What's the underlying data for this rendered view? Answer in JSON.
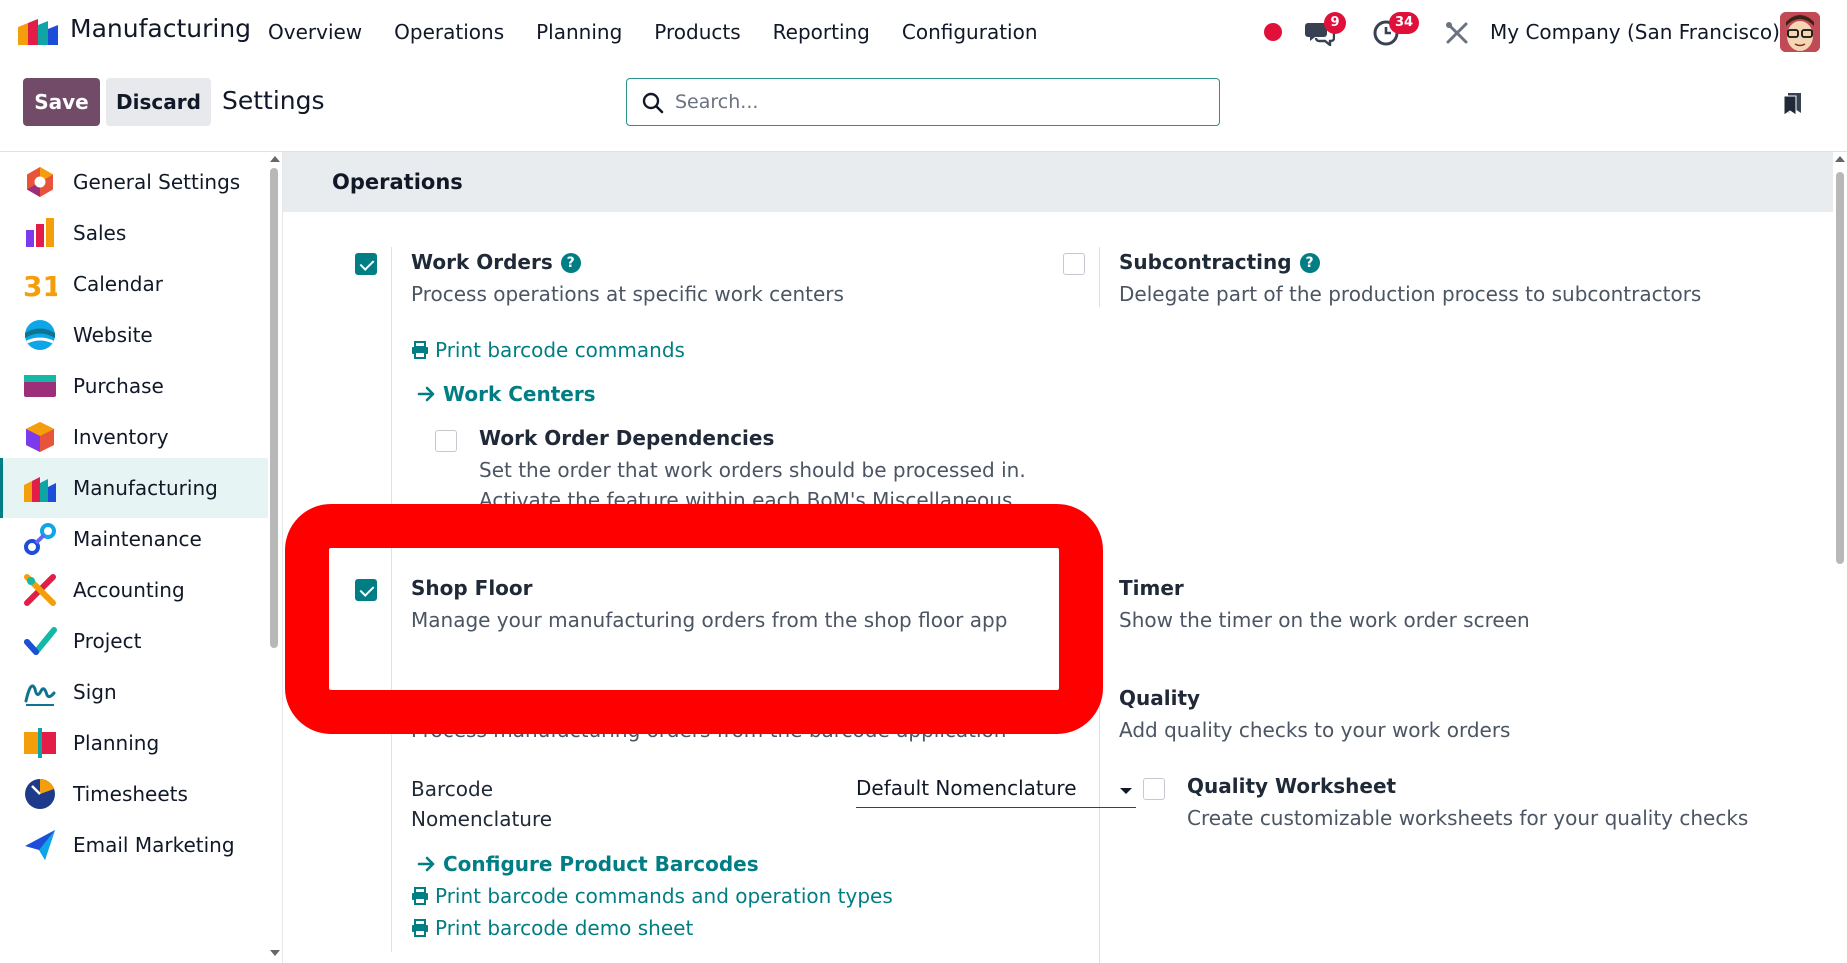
{
  "topnav": {
    "app_name": "Manufacturing",
    "menu": [
      "Overview",
      "Operations",
      "Planning",
      "Products",
      "Reporting",
      "Configuration"
    ],
    "messages_count": "9",
    "activities_count": "34",
    "company": "My Company (San Francisco)"
  },
  "control": {
    "save_label": "Save",
    "discard_label": "Discard",
    "breadcrumb": "Settings",
    "search_placeholder": "Search..."
  },
  "sidebar": {
    "items": [
      {
        "label": "General Settings",
        "icon": "general-settings-icon"
      },
      {
        "label": "Sales",
        "icon": "sales-icon"
      },
      {
        "label": "Calendar",
        "icon": "calendar-icon"
      },
      {
        "label": "Website",
        "icon": "website-icon"
      },
      {
        "label": "Purchase",
        "icon": "purchase-icon"
      },
      {
        "label": "Inventory",
        "icon": "inventory-icon"
      },
      {
        "label": "Manufacturing",
        "icon": "manufacturing-icon",
        "active": true
      },
      {
        "label": "Maintenance",
        "icon": "maintenance-icon"
      },
      {
        "label": "Accounting",
        "icon": "accounting-icon"
      },
      {
        "label": "Project",
        "icon": "project-icon"
      },
      {
        "label": "Sign",
        "icon": "sign-icon"
      },
      {
        "label": "Planning",
        "icon": "planning-icon"
      },
      {
        "label": "Timesheets",
        "icon": "timesheets-icon"
      },
      {
        "label": "Email Marketing",
        "icon": "email-marketing-icon"
      }
    ],
    "calendar_icon_text": "31"
  },
  "main": {
    "section_title": "Operations",
    "work_orders": {
      "title": "Work Orders",
      "desc": "Process operations at specific work centers",
      "checked": true,
      "print_link": "Print barcode commands",
      "work_centers_link": "Work Centers",
      "dependencies": {
        "title": "Work Order Dependencies",
        "desc": "Set the order that work orders should be processed in.",
        "desc2": "Activate the feature within each BoM's Miscellaneous",
        "checked": false
      }
    },
    "subcontracting": {
      "title": "Subcontracting",
      "desc": "Delegate part of the production process to subcontractors",
      "checked": false
    },
    "shop_floor": {
      "title": "Shop Floor",
      "desc": "Manage your manufacturing orders from the shop floor app",
      "checked": true
    },
    "timer": {
      "title": "Timer",
      "desc": "Show the timer on the work order screen"
    },
    "barcode": {
      "desc": "Process manufacturing orders from the barcode application",
      "nomenclature_label_1": "Barcode",
      "nomenclature_label_2": "Nomenclature",
      "nomenclature_value": "Default Nomenclature",
      "configure_link": "Configure Product Barcodes",
      "print_commands_link": "Print barcode commands and operation types",
      "print_demo_link": "Print barcode demo sheet"
    },
    "quality": {
      "title": "Quality",
      "desc": "Add quality checks to your work orders",
      "worksheet": {
        "title": "Quality Worksheet",
        "desc": "Create customizable worksheets for your quality checks",
        "checked": false
      }
    }
  },
  "colors": {
    "brand": "#714b67",
    "accent": "#017e84",
    "badge": "#e0103a",
    "highlight": "#ff0000"
  }
}
